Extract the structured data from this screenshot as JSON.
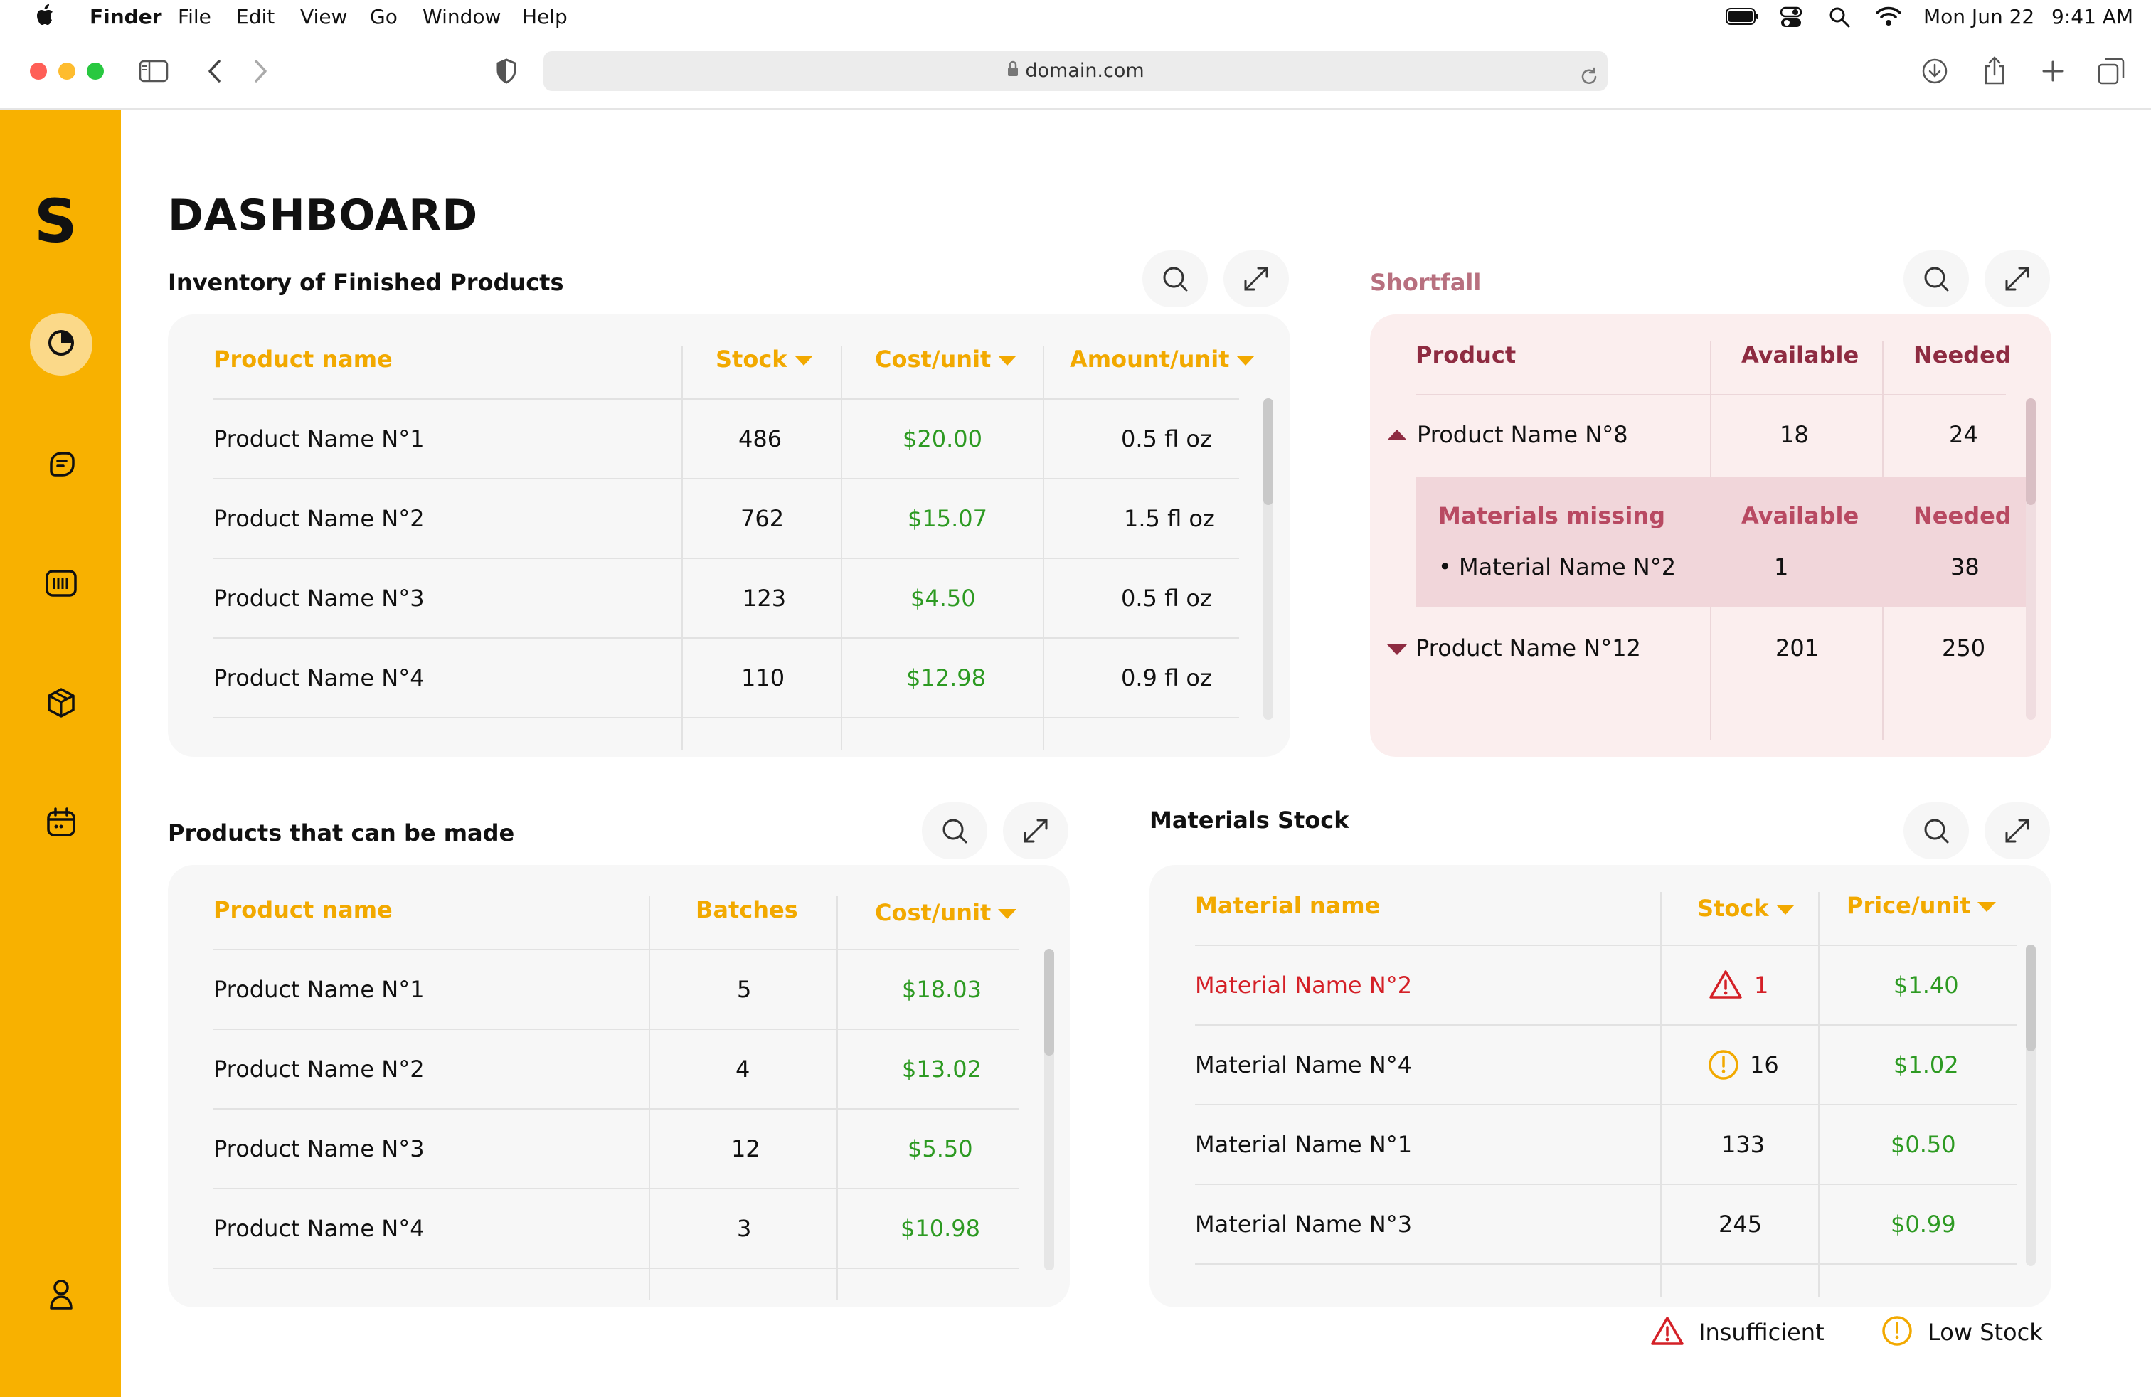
{
  "menubar": {
    "app": "Finder",
    "menus": [
      "File",
      "Edit",
      "View",
      "Go",
      "Window",
      "Help"
    ],
    "date": "Mon Jun 22",
    "time": "9:41 AM"
  },
  "browser": {
    "url": "domain.com"
  },
  "sidebar": {
    "logo": "S",
    "items": [
      "dashboard",
      "products",
      "production",
      "materials",
      "calendar",
      "user"
    ]
  },
  "page": {
    "title": "DASHBOARD"
  },
  "inventory": {
    "title": "Inventory of Finished Products",
    "headers": [
      "Product name",
      "Stock",
      "Cost/unit",
      "Amount/unit"
    ],
    "rows": [
      [
        "Product Name N°1",
        "486",
        "$20.00",
        "0.5 fl oz"
      ],
      [
        "Product Name N°2",
        "762",
        "$15.07",
        "1.5 fl oz"
      ],
      [
        "Product Name N°3",
        "123",
        "$4.50",
        "0.5 fl oz"
      ],
      [
        "Product Name N°4",
        "110",
        "$12.98",
        "0.9 fl oz"
      ]
    ]
  },
  "shortfall": {
    "title": "Shortfall",
    "headers": [
      "Product",
      "Available",
      "Needed"
    ],
    "rows": [
      {
        "name": "Product Name N°8",
        "available": "18",
        "needed": "24"
      },
      {
        "name": "Product Name N°12",
        "available": "201",
        "needed": "250"
      }
    ],
    "sub": {
      "headers": [
        "Materials missing",
        "Available",
        "Needed"
      ],
      "rows": [
        {
          "name": "• Material Name N°2",
          "available": "1",
          "needed": "38"
        }
      ]
    }
  },
  "makeable": {
    "title": "Products that can be made",
    "headers": [
      "Product name",
      "Batches",
      "Cost/unit"
    ],
    "rows": [
      [
        "Product Name N°1",
        "5",
        "$18.03"
      ],
      [
        "Product Name N°2",
        "4",
        "$13.02"
      ],
      [
        "Product Name N°3",
        "12",
        "$5.50"
      ],
      [
        "Product Name N°4",
        "3",
        "$10.98"
      ]
    ]
  },
  "materials": {
    "title": "Materials Stock",
    "headers": [
      "Material name",
      "Stock",
      "Price/unit"
    ],
    "rows": [
      [
        "Material Name N°2",
        "1",
        "$1.40"
      ],
      [
        "Material Name N°4",
        "16",
        "$1.02"
      ],
      [
        "Material Name N°1",
        "133",
        "$0.50"
      ],
      [
        "Material Name N°3",
        "245",
        "$0.99"
      ]
    ]
  },
  "legend": {
    "insufficient": "Insufficient",
    "low": "Low Stock"
  },
  "colors": {
    "accent": "#f8b100",
    "green": "#2d9a22",
    "red": "#d42027",
    "pink": "#fbeeee",
    "maroon": "#8e2b41"
  }
}
